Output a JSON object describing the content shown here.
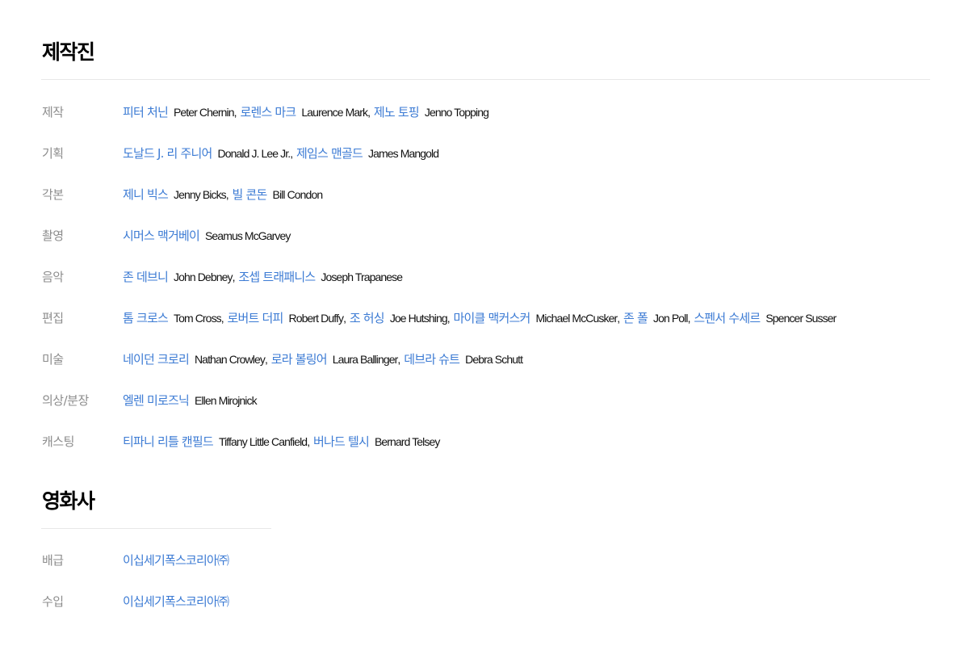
{
  "sections": {
    "crew_title": "제작진",
    "studio_title": "영화사"
  },
  "crew": [
    {
      "role": "제작",
      "people": [
        {
          "ko": "피터 처닌",
          "en": "Peter Chernin"
        },
        {
          "ko": "로렌스 마크",
          "en": "Laurence Mark"
        },
        {
          "ko": "제노 토핑",
          "en": "Jenno Topping"
        }
      ]
    },
    {
      "role": "기획",
      "people": [
        {
          "ko": "도날드 J. 리 주니어",
          "en": "Donald J. Lee Jr."
        },
        {
          "ko": "제임스 맨골드",
          "en": "James Mangold"
        }
      ]
    },
    {
      "role": "각본",
      "people": [
        {
          "ko": "제니 빅스",
          "en": "Jenny Bicks"
        },
        {
          "ko": "빌 콘돈",
          "en": "Bill Condon"
        }
      ]
    },
    {
      "role": "촬영",
      "people": [
        {
          "ko": "시머스 맥거베이",
          "en": "Seamus McGarvey"
        }
      ]
    },
    {
      "role": "음악",
      "people": [
        {
          "ko": "존 데브니",
          "en": "John Debney"
        },
        {
          "ko": "조셉 트래패니스",
          "en": "Joseph Trapanese"
        }
      ]
    },
    {
      "role": "편집",
      "people": [
        {
          "ko": "톰 크로스",
          "en": "Tom Cross"
        },
        {
          "ko": "로버트 더피",
          "en": "Robert Duffy"
        },
        {
          "ko": "조 허싱",
          "en": "Joe Hutshing"
        },
        {
          "ko": "마이클 맥커스커",
          "en": "Michael McCusker"
        },
        {
          "ko": "존 폴",
          "en": "Jon Poll"
        },
        {
          "ko": "스펜서 수세르",
          "en": "Spencer Susser"
        }
      ]
    },
    {
      "role": "미술",
      "people": [
        {
          "ko": "네이던 크로리",
          "en": "Nathan Crowley"
        },
        {
          "ko": "로라 볼링어",
          "en": "Laura Ballinger"
        },
        {
          "ko": "데브라 슈트",
          "en": "Debra Schutt"
        }
      ]
    },
    {
      "role": "의상/분장",
      "people": [
        {
          "ko": "엘렌 미로즈닉",
          "en": "Ellen Mirojnick"
        }
      ]
    },
    {
      "role": "캐스팅",
      "people": [
        {
          "ko": "티파니 리틀 캔필드",
          "en": "Tiffany Little Canfield"
        },
        {
          "ko": "버나드 텔시",
          "en": "Bernard Telsey"
        }
      ]
    }
  ],
  "studios": [
    {
      "role": "배급",
      "company": "이십세기폭스코리아㈜"
    },
    {
      "role": "수입",
      "company": "이십세기폭스코리아㈜"
    }
  ],
  "colors": {
    "link": "#3c7bd4",
    "label": "#8c8c8c",
    "divider": "#e8e8e8"
  }
}
